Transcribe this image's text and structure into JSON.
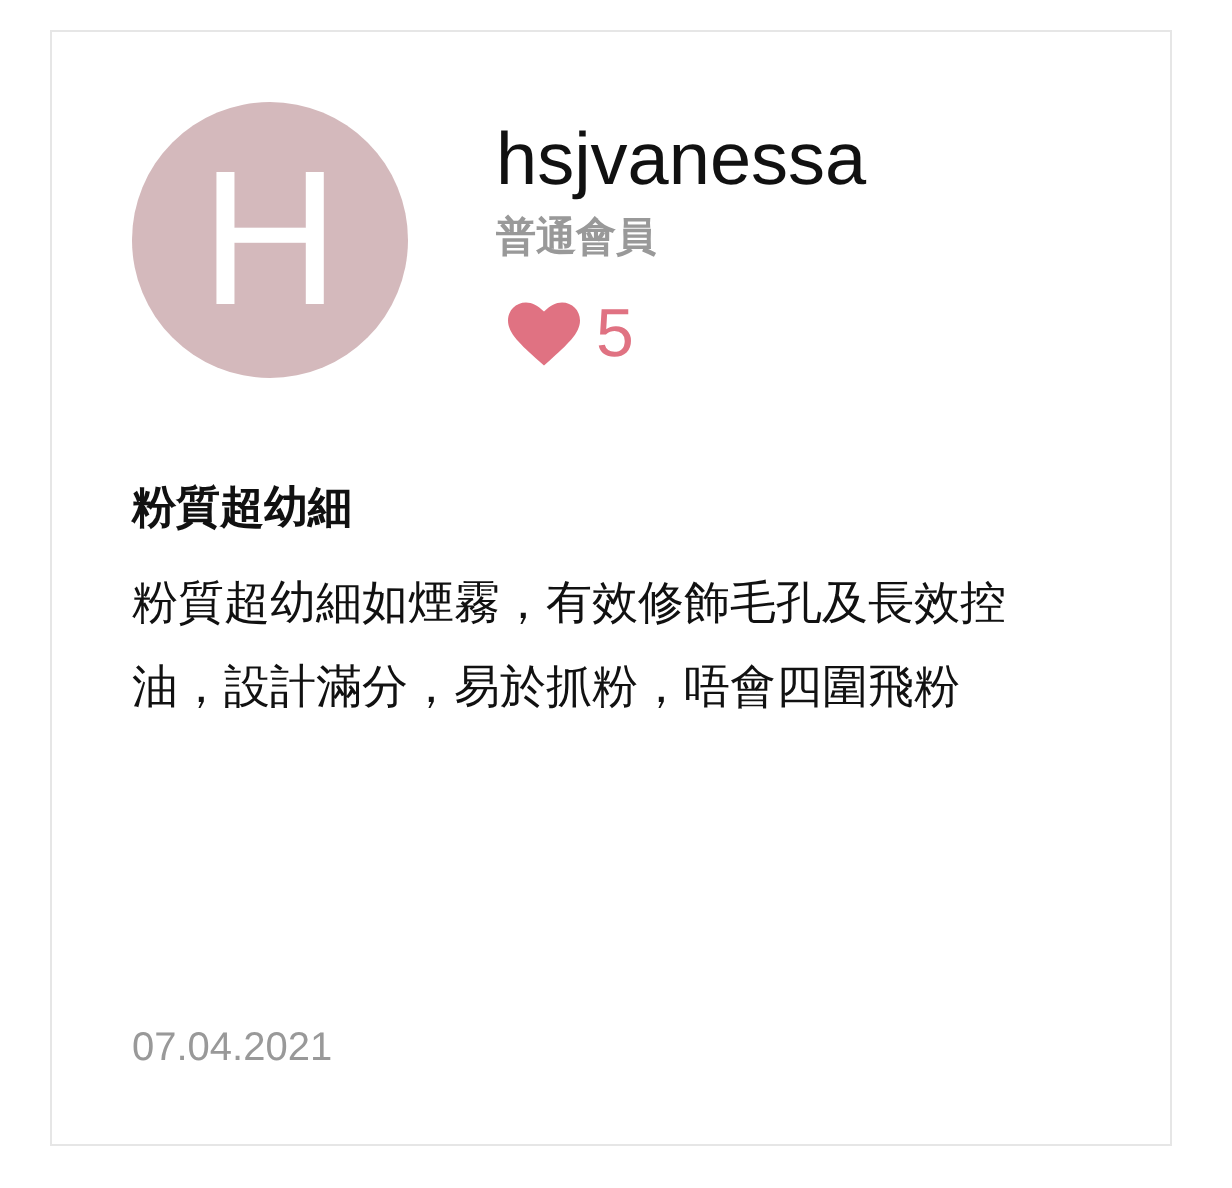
{
  "review": {
    "avatar_initial": "H",
    "username": "hsjvanessa",
    "member_level": "普通會員",
    "likes": "5",
    "title": "粉質超幼細",
    "body": "粉質超幼細如煙霧，有效修飾毛孔及長效控油，設計滿分，易於抓粉，唔會四圍飛粉",
    "date": "07.04.2021"
  }
}
